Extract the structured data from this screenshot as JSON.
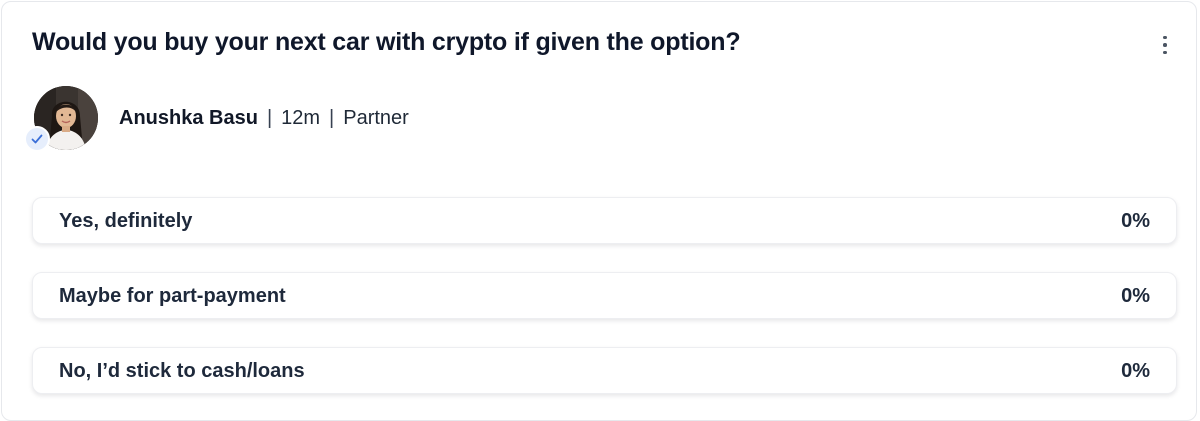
{
  "poll": {
    "question": "Would you buy your next car with crypto if given the option?",
    "menu_icon": "more-vertical-icon",
    "author": {
      "name": "Anushka Basu",
      "time": "12m",
      "role": "Partner",
      "separator": "|",
      "verified_icon": "check-icon"
    },
    "options": [
      {
        "label": "Yes, definitely",
        "percent_text": "0%",
        "percent": 0
      },
      {
        "label": "Maybe for part-payment",
        "percent_text": "0%",
        "percent": 0
      },
      {
        "label": "No, I’d stick to cash/loans",
        "percent_text": "0%",
        "percent": 0
      }
    ]
  },
  "colors": {
    "text": "#0f172a",
    "option_border": "#edeef1",
    "verified_bg": "#e6eefc",
    "verified_check": "#3b6fd8"
  }
}
